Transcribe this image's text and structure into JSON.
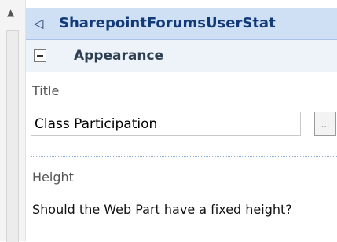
{
  "header": {
    "title": "SharepointForumsUserStat"
  },
  "section": {
    "title": "Appearance"
  },
  "fields": {
    "title_label": "Title",
    "title_value": "Class Participation",
    "builder_label": "...",
    "height_label": "Height",
    "height_description": "Should the Web Part have a fixed height?"
  },
  "icons": {
    "scroll_up": "scroll-up-arrow",
    "back": "back-arrow",
    "collapse": "minus-box"
  },
  "colors": {
    "header_bg": "#cfe0f4",
    "header_text": "#123a78",
    "section_bg": "#eef3f9",
    "divider": "#8ab0d9"
  }
}
